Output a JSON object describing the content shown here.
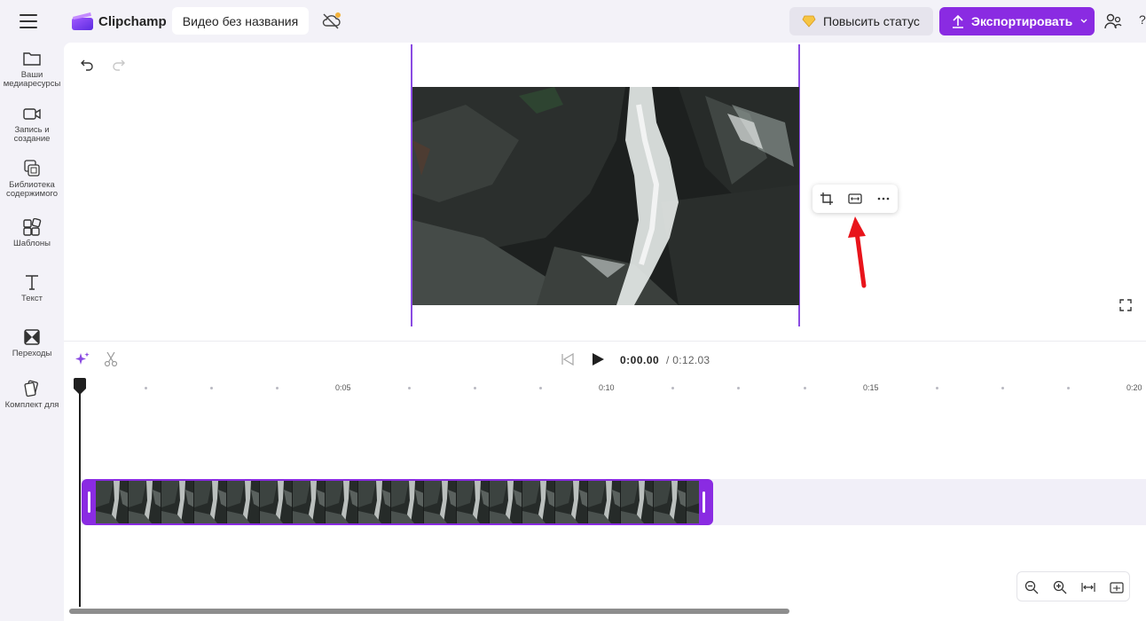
{
  "app": {
    "name": "Clipchamp",
    "project_title": "Видео без названия",
    "upgrade_label": "Повысить статус",
    "export_label": "Экспортировать"
  },
  "sidebar": {
    "items": [
      {
        "label": "Ваши медиаресурсы",
        "icon": "folder-icon"
      },
      {
        "label": "Запись и создание",
        "icon": "video-camera-icon"
      },
      {
        "label": "Библиотека содержимого",
        "icon": "content-library-icon"
      },
      {
        "label": "Шаблоны",
        "icon": "templates-icon"
      },
      {
        "label": "Текст",
        "icon": "text-icon"
      },
      {
        "label": "Переходы",
        "icon": "transitions-icon"
      },
      {
        "label": "Комплект для",
        "icon": "brand-kit-icon"
      }
    ]
  },
  "playback": {
    "current_time": "0:00.00",
    "total_time": "/ 0:12.03"
  },
  "timeline": {
    "ticks": [
      "0:05",
      "0:10",
      "0:15",
      "0:20"
    ]
  },
  "colors": {
    "accent": "#8a2be2",
    "stage_line": "#8a4be2",
    "annotation_arrow": "#e8141b"
  }
}
